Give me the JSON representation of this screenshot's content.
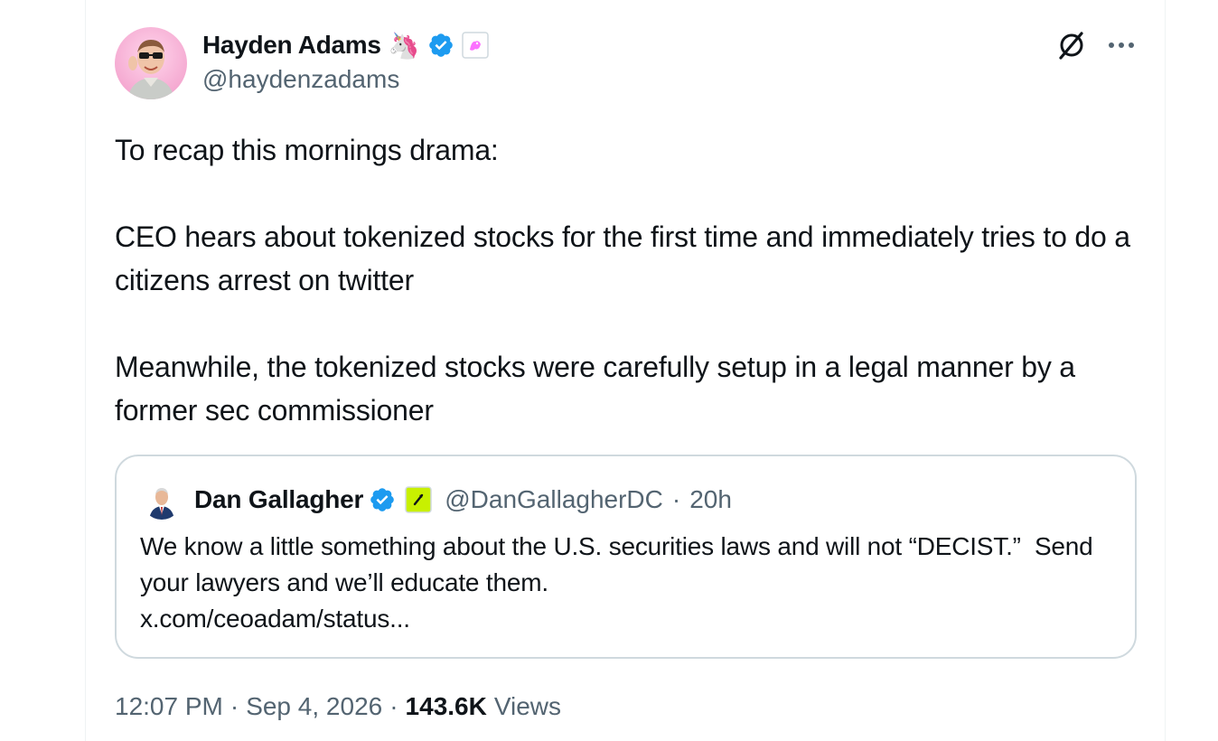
{
  "author": {
    "display_name": "Hayden Adams",
    "handle": "@haydenzadams",
    "name_emoji": "🦄"
  },
  "tweet": {
    "text": "To recap this mornings drama:\n\nCEO hears about tokenized stocks for the first time and immediately tries to do a citizens arrest on twitter\n\nMeanwhile, the tokenized stocks were carefully setup in a legal manner by a  former sec commissioner"
  },
  "quote": {
    "display_name": "Dan Gallagher",
    "handle": "@DanGallagherDC",
    "separator": "·",
    "time": "20h",
    "text": "We know a little something about the U.S. securities laws and will not “DECIST.”  Send your lawyers and we’ll educate them.\nx.com/ceoadam/status..."
  },
  "meta": {
    "time": "12:07 PM",
    "separator1": "·",
    "date": "Sep 4, 2026",
    "separator2": "·",
    "views_count": "143.6K",
    "views_label": "Views"
  },
  "icons": {
    "verified": "verified-badge-icon",
    "grok": "grok-icon",
    "more": "more-icon",
    "affiliate": "affiliate-badge-icon"
  },
  "colors": {
    "verified_blue": "#1d9bf0",
    "secondary_text": "#536471",
    "primary_text": "#0f1419",
    "border": "#cfd9de",
    "affiliate_lime": "#c8f000"
  }
}
